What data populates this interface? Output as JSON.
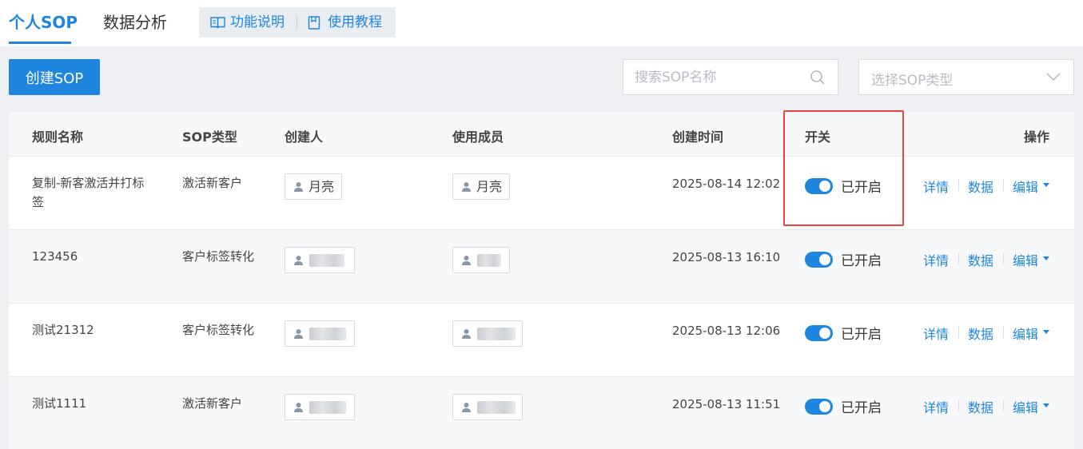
{
  "tabs": {
    "active": "个人SOP",
    "inactive": "数据分析"
  },
  "help": {
    "features": "功能说明",
    "tutorial": "使用教程"
  },
  "toolbar": {
    "create_label": "创建SOP",
    "search_placeholder": "搜索SOP名称",
    "type_select_placeholder": "选择SOP类型"
  },
  "table": {
    "headers": {
      "name": "规则名称",
      "type": "SOP类型",
      "creator": "创建人",
      "members": "使用成员",
      "created_at": "创建时间",
      "switch": "开关",
      "actions": "操作"
    },
    "rows": [
      {
        "name": "复制-新客激活并打标签",
        "type": "激活新客户",
        "creator": "月亮",
        "member": "月亮",
        "created_at": "2025-08-14 12:02",
        "status": "已开启"
      },
      {
        "name": "123456",
        "type": "客户标签转化",
        "creator": "",
        "member": "",
        "created_at": "2025-08-13 16:10",
        "status": "已开启"
      },
      {
        "name": "测试21312",
        "type": "客户标签转化",
        "creator": "",
        "member": "",
        "created_at": "2025-08-13 12:06",
        "status": "已开启"
      },
      {
        "name": "测试1111",
        "type": "激活新客户",
        "creator": "",
        "member": "",
        "created_at": "2025-08-13 11:51",
        "status": "已开启"
      }
    ],
    "actions": {
      "detail": "详情",
      "data": "数据",
      "edit": "编辑"
    }
  },
  "colors": {
    "primary": "#1f86e0",
    "highlight": "#e8453c"
  },
  "icons": {
    "features": "open-book-icon",
    "tutorial": "document-icon",
    "search": "search-icon",
    "select": "chevron-down-icon",
    "user": "person-icon"
  }
}
